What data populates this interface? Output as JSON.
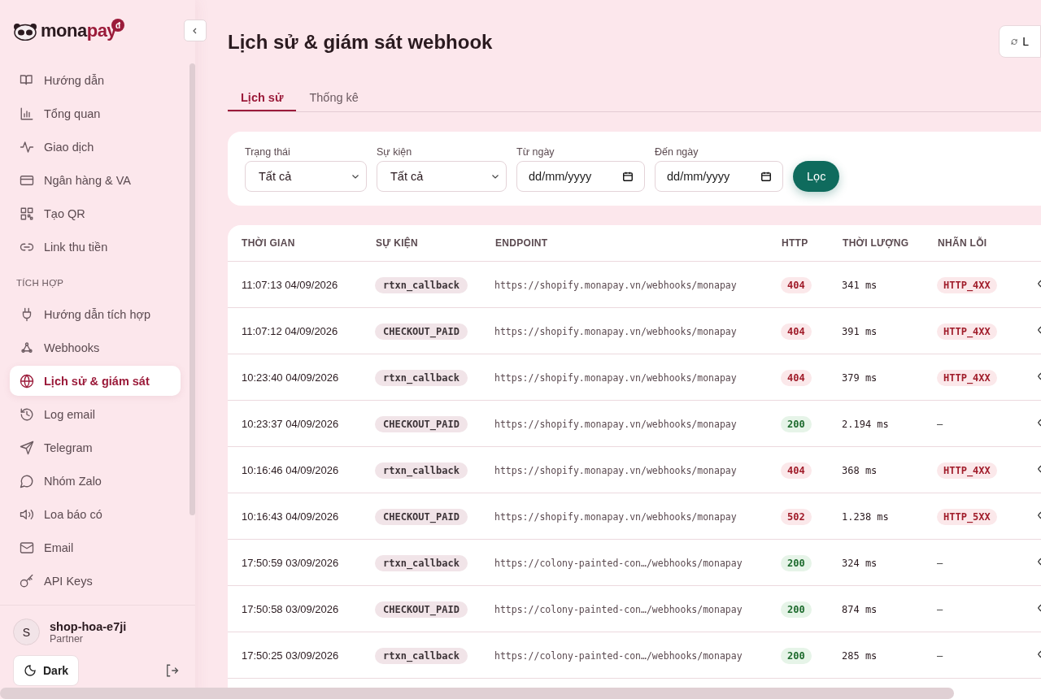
{
  "logo": {
    "name": "mona",
    "accent": "pay",
    "badge": "đ"
  },
  "sidebar": {
    "sections": [
      {
        "items": [
          {
            "label": "Hướng dẫn",
            "selected": false
          },
          {
            "label": "Tổng quan",
            "selected": false
          },
          {
            "label": "Giao dịch",
            "selected": false
          },
          {
            "label": "Ngân hàng & VA",
            "selected": false
          },
          {
            "label": "Tạo QR",
            "selected": false
          },
          {
            "label": "Link thu tiền",
            "selected": false
          }
        ]
      },
      {
        "heading": "TÍCH HỢP",
        "items": [
          {
            "label": "Hướng dẫn tích hợp",
            "selected": false
          },
          {
            "label": "Webhooks",
            "selected": false
          },
          {
            "label": "Lịch sử & giám sát",
            "selected": true
          },
          {
            "label": "Log email",
            "selected": false
          },
          {
            "label": "Telegram",
            "selected": false
          },
          {
            "label": "Nhóm Zalo",
            "selected": false
          },
          {
            "label": "Loa báo có",
            "selected": false
          },
          {
            "label": "Email",
            "selected": false
          },
          {
            "label": "API Keys",
            "selected": false
          }
        ]
      }
    ]
  },
  "user": {
    "initial": "S",
    "name": "shop-hoa-e7ji",
    "role": "Partner"
  },
  "theme_button": "Dark",
  "page": {
    "title": "Lịch sử & giám sát webhook",
    "refresh_button": "L"
  },
  "tabs": [
    {
      "label": "Lịch sử",
      "selected": true
    },
    {
      "label": "Thống kê",
      "selected": false
    }
  ],
  "filters": [
    {
      "kind": "select",
      "label": "Trạng thái",
      "value": "Tất cả"
    },
    {
      "kind": "select",
      "label": "Sự kiện",
      "value": "Tất cả"
    },
    {
      "kind": "date",
      "label": "Từ ngày",
      "placeholder": "dd/mm/yyyy"
    },
    {
      "kind": "date",
      "label": "Đến ngày",
      "placeholder": "dd/mm/yyyy"
    }
  ],
  "filter_button": "Lọc",
  "table": {
    "columns": [
      "THỜI GIAN",
      "SỰ KIỆN",
      "ENDPOINT",
      "HTTP",
      "THỜI LƯỢNG",
      "NHÃN LỖI"
    ],
    "rows": [
      {
        "time": "11:07:13 04/09/2026",
        "event": "rtxn_callback",
        "endpoint": "https://shopify.monapay.vn/webhooks/monapay",
        "http": "404",
        "kind": "error",
        "duration": "341 ms",
        "error_label": "HTTP_4XX"
      },
      {
        "time": "11:07:12 04/09/2026",
        "event": "CHECKOUT_PAID",
        "endpoint": "https://shopify.monapay.vn/webhooks/monapay",
        "http": "404",
        "kind": "error",
        "duration": "391 ms",
        "error_label": "HTTP_4XX"
      },
      {
        "time": "10:23:40 04/09/2026",
        "event": "rtxn_callback",
        "endpoint": "https://shopify.monapay.vn/webhooks/monapay",
        "http": "404",
        "kind": "error",
        "duration": "379 ms",
        "error_label": "HTTP_4XX"
      },
      {
        "time": "10:23:37 04/09/2026",
        "event": "CHECKOUT_PAID",
        "endpoint": "https://shopify.monapay.vn/webhooks/monapay",
        "http": "200",
        "kind": "success",
        "duration": "2.194 ms",
        "error_label": "—"
      },
      {
        "time": "10:16:46 04/09/2026",
        "event": "rtxn_callback",
        "endpoint": "https://shopify.monapay.vn/webhooks/monapay",
        "http": "404",
        "kind": "error",
        "duration": "368 ms",
        "error_label": "HTTP_4XX"
      },
      {
        "time": "10:16:43 04/09/2026",
        "event": "CHECKOUT_PAID",
        "endpoint": "https://shopify.monapay.vn/webhooks/monapay",
        "http": "502",
        "kind": "error",
        "duration": "1.238 ms",
        "error_label": "HTTP_5XX"
      },
      {
        "time": "17:50:59 03/09/2026",
        "event": "rtxn_callback",
        "endpoint": "https://colony-painted-con…/webhooks/monapay",
        "http": "200",
        "kind": "success",
        "duration": "324 ms",
        "error_label": "—"
      },
      {
        "time": "17:50:58 03/09/2026",
        "event": "CHECKOUT_PAID",
        "endpoint": "https://colony-painted-con…/webhooks/monapay",
        "http": "200",
        "kind": "success",
        "duration": "874 ms",
        "error_label": "—"
      },
      {
        "time": "17:50:25 03/09/2026",
        "event": "rtxn_callback",
        "endpoint": "https://colony-painted-con…/webhooks/monapay",
        "http": "200",
        "kind": "success",
        "duration": "285 ms",
        "error_label": "—"
      }
    ]
  }
}
